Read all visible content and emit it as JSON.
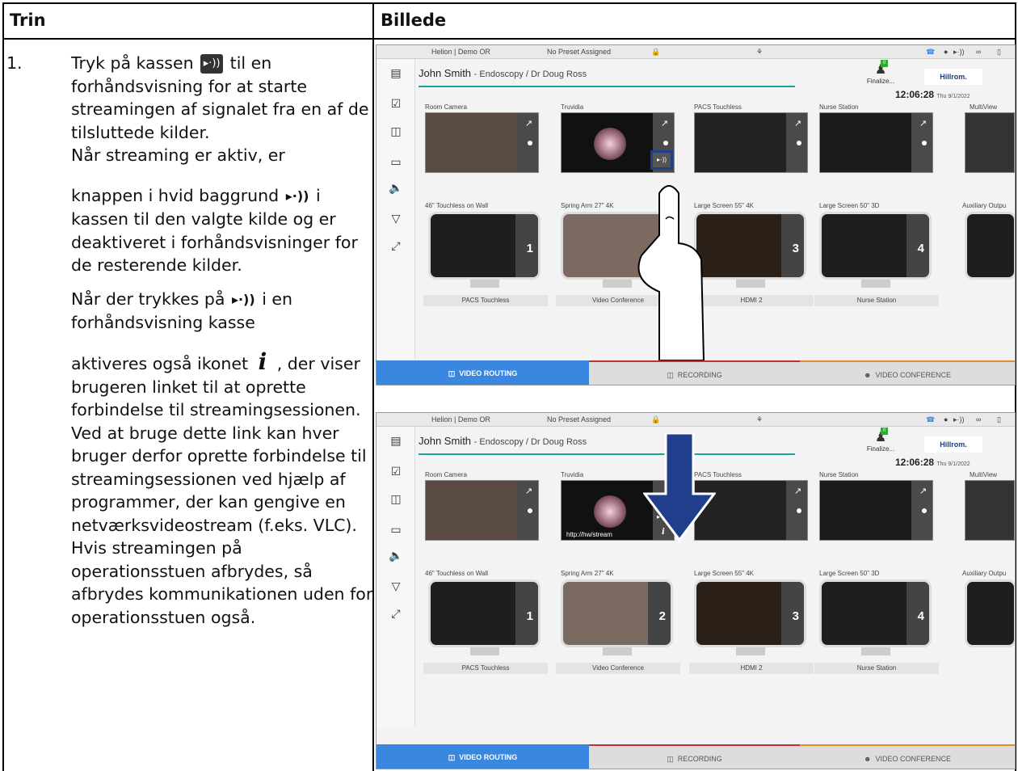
{
  "table": {
    "col_step": "Trin",
    "col_image": "Billede"
  },
  "step": {
    "number": "1.",
    "p1_a": "Tryk på kassen",
    "p1_b": "til en forhåndsvisning for at starte streamingen af signalet fra en af de tilsluttede kilder.",
    "p2": "Når streaming er aktiv, er",
    "p3_a": "knappen i hvid baggrund",
    "p3_b": "i kassen til den valgte kilde og er deaktiveret i forhåndsvisninger for de resterende kilder.",
    "p4_a": "Når der trykkes på",
    "p4_b": "i en forhåndsvisning kasse",
    "p5_a": "aktiveres også ikonet",
    "p5_b": ", der viser brugeren linket til at oprette forbindelse til streamingsessionen. Ved at bruge dette link kan hver bruger derfor oprette forbindelse til streamingsessionen ved hjælp af programmer, der kan gengive en netværksvideostream (f.eks. VLC). Hvis streamingen på operationsstuen afbrydes, så afbrydes kommunikationen uden for operationsstuen også.",
    "stream_glyph": "▸·))",
    "info_glyph": "i"
  },
  "screen": {
    "room": "Helion | Demo OR",
    "preset": "No Preset Assigned",
    "patient_name": "John Smith",
    "patient_detail": "- Endoscopy / Dr Doug Ross",
    "finalize": "Finalize...",
    "badge": "0",
    "brand": "Hillrom.",
    "time": "12:06:28",
    "date": "Thu 9/1/2022",
    "sources": [
      "Room Camera",
      "Truvidia",
      "PACS Touchless",
      "Nurse Station",
      "MultiView"
    ],
    "destinations": [
      "46\" Touchless on Wall",
      "Spring Arm 27\" 4K",
      "Large Screen 55\" 4K",
      "Large Screen 50\" 3D",
      "Auxiliary Outpu"
    ],
    "outputs": [
      "PACS Touchless",
      "Video Conference",
      "HDMI 2",
      "Nurse Station"
    ],
    "monitor_numbers": [
      "1",
      "2",
      "3",
      "4"
    ],
    "stream_link": "http://hw/stream",
    "tabs": {
      "routing": "VIDEO ROUTING",
      "recording": "RECORDING",
      "conference": "VIDEO CONFERENCE"
    }
  },
  "colors": {
    "accent_blue": "#3a87e0",
    "teal_line": "#1aa39a",
    "highlight_box": "#1f3f8c"
  }
}
